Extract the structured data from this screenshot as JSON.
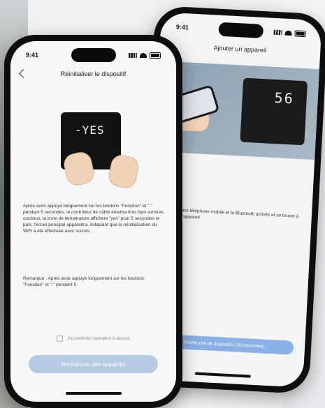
{
  "front": {
    "time": "9:41",
    "title": "Réinitialiser le dispositif",
    "display": "-YES",
    "paragraph1": "Après avoir appuyé longuement sur les boutons \"Fonction\" et \"-\" pendant 5 secondes, le contrôleur de câble émettra trois bips sonores continus, la zone de température affichera \"yes\" pour 5 secondes et puis, l'écran principal apparaîtra, indiquant que la réinitialisation du WiFi a été effectuée avec succès.",
    "paragraph2": "Remarque : Après avoir appuyé longuement sur les boutons \"Fonction\" et \"-\" pendant 5",
    "confirm_label": "J'ai confirmé l'opération ci-dessus",
    "button": "Rechercher des appareils"
  },
  "back": {
    "time": "9:41",
    "title": "Ajouter un appareil",
    "display": "56",
    "text": "...s que votre téléphone mobile et le Bluetooth activés et se trouve à moins de l'appareil.",
    "button": "Recherche de dispositifs (10 Secondes)"
  }
}
